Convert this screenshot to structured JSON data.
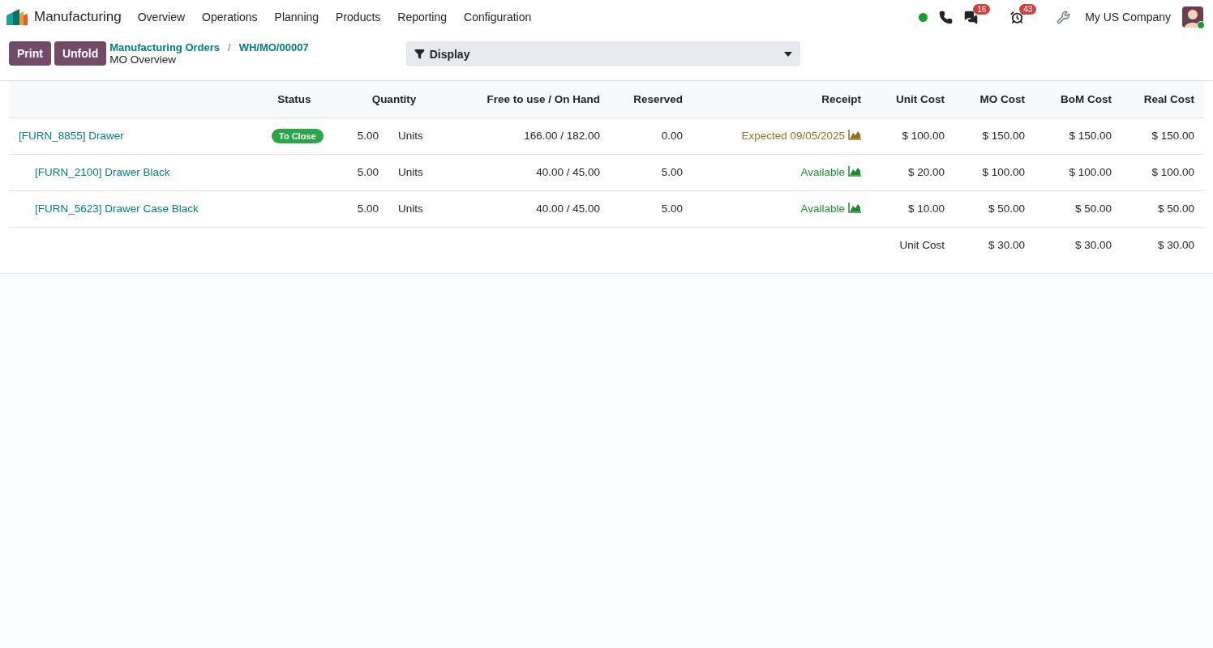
{
  "navbar": {
    "app_name": "Manufacturing",
    "menu": [
      "Overview",
      "Operations",
      "Planning",
      "Products",
      "Reporting",
      "Configuration"
    ],
    "chat_count": "16",
    "activity_count": "43",
    "company": "My US Company"
  },
  "control_panel": {
    "buttons": [
      "Print",
      "Unfold"
    ],
    "breadcrumbs": [
      "Manufacturing Orders",
      "WH/MO/00007"
    ],
    "breadcrumb_separator": "/",
    "title": "MO Overview",
    "display_label": "Display"
  },
  "table": {
    "columns": [
      "Status",
      "Quantity",
      "Free to use / On Hand",
      "Reserved",
      "Receipt",
      "Unit Cost",
      "MO Cost",
      "BoM Cost",
      "Real Cost"
    ],
    "rows": [
      {
        "product": "[FURN_8855] Drawer",
        "status": "To Close",
        "quantity": "5.00",
        "uom": "Units",
        "free_on_hand": "166.00 / 182.00",
        "reserved": "0.00",
        "receipt": "Expected 09/05/2025",
        "color": "#8e7321",
        "unit_cost": "$ 100.00",
        "mo_cost": "$ 150.00",
        "bom_cost": "$ 150.00",
        "real_cost": "$ 150.00",
        "children": [
          {
            "product": "[FURN_2100] Drawer Black",
            "quantity": "5.00",
            "uom": "Units",
            "free_on_hand": "40.00 / 45.00",
            "reserved": "5.00",
            "receipt": "Available",
            "color": "#1f8a34",
            "unit_cost": "$ 20.00",
            "mo_cost": "$ 100.00",
            "bom_cost": "$ 100.00",
            "real_cost": "$ 100.00"
          },
          {
            "product": "[FURN_5623] Drawer Case Black",
            "quantity": "5.00",
            "uom": "Units",
            "free_on_hand": "40.00 / 45.00",
            "reserved": "5.00",
            "receipt": "Available",
            "color": "#1f8a34",
            "unit_cost": "$ 10.00",
            "mo_cost": "$ 50.00",
            "bom_cost": "$ 50.00",
            "real_cost": "$ 50.00"
          }
        ]
      }
    ],
    "footer": {
      "label": "Unit Cost",
      "mo_cost": "$ 30.00",
      "bom_cost": "$ 30.00",
      "real_cost": "$ 30.00"
    }
  }
}
